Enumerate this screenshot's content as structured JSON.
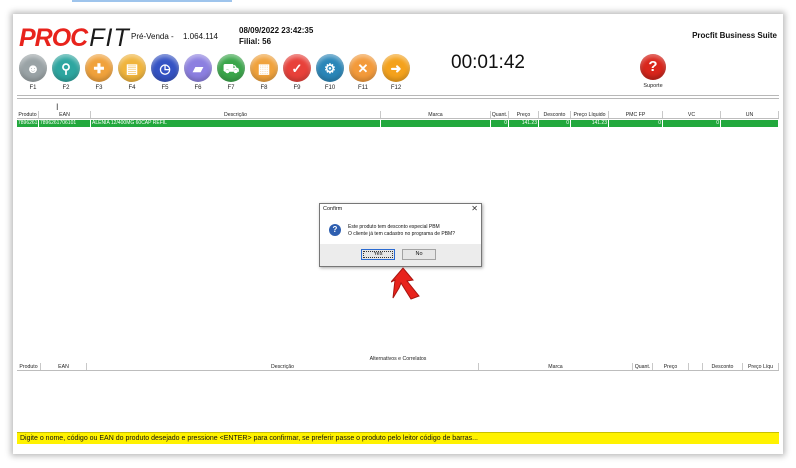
{
  "app": {
    "logo_proc": "PROC",
    "logo_fit": "FIT",
    "mode": "Pré-Venda -",
    "version": "1.064.114",
    "datetime": "08/09/2022 23:42:35",
    "filial": "Filial: 56",
    "brand": "Procfit Business Suite",
    "timer": "00:01:42",
    "cursor": "I"
  },
  "toolbar": [
    {
      "key": "F1",
      "icon": "users-icon",
      "color": "#9aa3a6",
      "glyph": "☻"
    },
    {
      "key": "F2",
      "icon": "search-icon",
      "color": "#2ea6a0",
      "glyph": "⚲"
    },
    {
      "key": "F3",
      "icon": "medicine-icon",
      "color": "#f0a23c",
      "glyph": "✚"
    },
    {
      "key": "F4",
      "icon": "card-icon",
      "color": "#f0b43c",
      "glyph": "▤"
    },
    {
      "key": "F5",
      "icon": "clock-icon",
      "color": "#3553c4",
      "glyph": "◷"
    },
    {
      "key": "F6",
      "icon": "truck-icon",
      "color": "#8c7fe0",
      "glyph": "▰"
    },
    {
      "key": "F7",
      "icon": "cart-icon",
      "color": "#3aa64a",
      "glyph": "⛟"
    },
    {
      "key": "F8",
      "icon": "document-icon",
      "color": "#f0a23c",
      "glyph": "▦"
    },
    {
      "key": "F9",
      "icon": "check-icon",
      "color": "#e8413a",
      "glyph": "✓"
    },
    {
      "key": "F10",
      "icon": "settings-icon",
      "color": "#2a86b8",
      "glyph": "⚙"
    },
    {
      "key": "F11",
      "icon": "cancel-icon",
      "color": "#f39a3a",
      "glyph": "✕"
    },
    {
      "key": "F12",
      "icon": "arrow-right-icon",
      "color": "#f4a21c",
      "glyph": "➜"
    }
  ],
  "support": {
    "label": "Suporte",
    "glyph": "?"
  },
  "grid": {
    "headers": [
      "Produto",
      "EAN",
      "Descrição",
      "Marca",
      "Quant.",
      "Preço",
      "Desconto",
      "Preço Líquido",
      "PMC FP",
      "VC",
      "UN"
    ],
    "row": [
      "7896261706101",
      "7896261706101",
      "ALENIA 12/400MG 60CAP REFIL",
      "",
      "0",
      "141.23",
      "0",
      "141.23",
      "0",
      "0",
      ""
    ]
  },
  "alternatives": {
    "title": "Alternativos e Correlatos",
    "headers": [
      "Produto",
      "EAN",
      "Descrição",
      "Marca",
      "Quant.",
      "Preço",
      "",
      "Desconto",
      "Preço Líqu"
    ]
  },
  "dialog": {
    "title": "Confirm",
    "close": "✕",
    "icon_glyph": "?",
    "message_line1": "Este produto tem desconto especial PBM",
    "message_line2": "O cliente já tem cadastro no programa de PBM?",
    "yes": "Yes",
    "no": "No"
  },
  "status": "Digite o nome, código ou EAN do produto desejado e pressione <ENTER> para confirmar, se preferir passe o produto pelo leitor código de barras..."
}
